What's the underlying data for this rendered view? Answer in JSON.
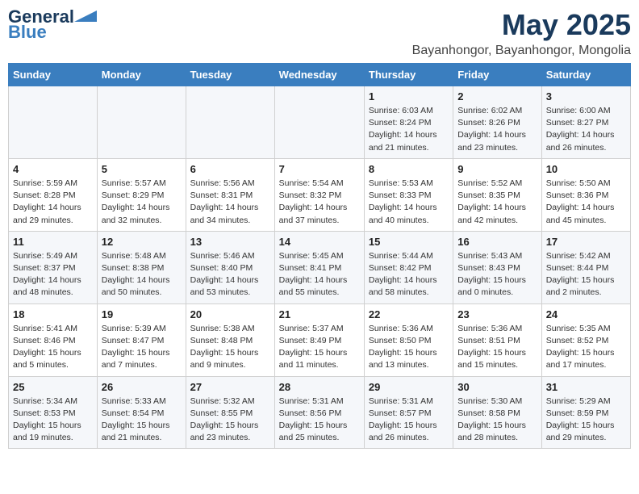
{
  "logo": {
    "general": "General",
    "blue": "Blue"
  },
  "title": "May 2025",
  "subtitle": "Bayanhongor, Bayanhongor, Mongolia",
  "headers": [
    "Sunday",
    "Monday",
    "Tuesday",
    "Wednesday",
    "Thursday",
    "Friday",
    "Saturday"
  ],
  "weeks": [
    [
      {
        "day": "",
        "info": ""
      },
      {
        "day": "",
        "info": ""
      },
      {
        "day": "",
        "info": ""
      },
      {
        "day": "",
        "info": ""
      },
      {
        "day": "1",
        "info": "Sunrise: 6:03 AM\nSunset: 8:24 PM\nDaylight: 14 hours\nand 21 minutes."
      },
      {
        "day": "2",
        "info": "Sunrise: 6:02 AM\nSunset: 8:26 PM\nDaylight: 14 hours\nand 23 minutes."
      },
      {
        "day": "3",
        "info": "Sunrise: 6:00 AM\nSunset: 8:27 PM\nDaylight: 14 hours\nand 26 minutes."
      }
    ],
    [
      {
        "day": "4",
        "info": "Sunrise: 5:59 AM\nSunset: 8:28 PM\nDaylight: 14 hours\nand 29 minutes."
      },
      {
        "day": "5",
        "info": "Sunrise: 5:57 AM\nSunset: 8:29 PM\nDaylight: 14 hours\nand 32 minutes."
      },
      {
        "day": "6",
        "info": "Sunrise: 5:56 AM\nSunset: 8:31 PM\nDaylight: 14 hours\nand 34 minutes."
      },
      {
        "day": "7",
        "info": "Sunrise: 5:54 AM\nSunset: 8:32 PM\nDaylight: 14 hours\nand 37 minutes."
      },
      {
        "day": "8",
        "info": "Sunrise: 5:53 AM\nSunset: 8:33 PM\nDaylight: 14 hours\nand 40 minutes."
      },
      {
        "day": "9",
        "info": "Sunrise: 5:52 AM\nSunset: 8:35 PM\nDaylight: 14 hours\nand 42 minutes."
      },
      {
        "day": "10",
        "info": "Sunrise: 5:50 AM\nSunset: 8:36 PM\nDaylight: 14 hours\nand 45 minutes."
      }
    ],
    [
      {
        "day": "11",
        "info": "Sunrise: 5:49 AM\nSunset: 8:37 PM\nDaylight: 14 hours\nand 48 minutes."
      },
      {
        "day": "12",
        "info": "Sunrise: 5:48 AM\nSunset: 8:38 PM\nDaylight: 14 hours\nand 50 minutes."
      },
      {
        "day": "13",
        "info": "Sunrise: 5:46 AM\nSunset: 8:40 PM\nDaylight: 14 hours\nand 53 minutes."
      },
      {
        "day": "14",
        "info": "Sunrise: 5:45 AM\nSunset: 8:41 PM\nDaylight: 14 hours\nand 55 minutes."
      },
      {
        "day": "15",
        "info": "Sunrise: 5:44 AM\nSunset: 8:42 PM\nDaylight: 14 hours\nand 58 minutes."
      },
      {
        "day": "16",
        "info": "Sunrise: 5:43 AM\nSunset: 8:43 PM\nDaylight: 15 hours\nand 0 minutes."
      },
      {
        "day": "17",
        "info": "Sunrise: 5:42 AM\nSunset: 8:44 PM\nDaylight: 15 hours\nand 2 minutes."
      }
    ],
    [
      {
        "day": "18",
        "info": "Sunrise: 5:41 AM\nSunset: 8:46 PM\nDaylight: 15 hours\nand 5 minutes."
      },
      {
        "day": "19",
        "info": "Sunrise: 5:39 AM\nSunset: 8:47 PM\nDaylight: 15 hours\nand 7 minutes."
      },
      {
        "day": "20",
        "info": "Sunrise: 5:38 AM\nSunset: 8:48 PM\nDaylight: 15 hours\nand 9 minutes."
      },
      {
        "day": "21",
        "info": "Sunrise: 5:37 AM\nSunset: 8:49 PM\nDaylight: 15 hours\nand 11 minutes."
      },
      {
        "day": "22",
        "info": "Sunrise: 5:36 AM\nSunset: 8:50 PM\nDaylight: 15 hours\nand 13 minutes."
      },
      {
        "day": "23",
        "info": "Sunrise: 5:36 AM\nSunset: 8:51 PM\nDaylight: 15 hours\nand 15 minutes."
      },
      {
        "day": "24",
        "info": "Sunrise: 5:35 AM\nSunset: 8:52 PM\nDaylight: 15 hours\nand 17 minutes."
      }
    ],
    [
      {
        "day": "25",
        "info": "Sunrise: 5:34 AM\nSunset: 8:53 PM\nDaylight: 15 hours\nand 19 minutes."
      },
      {
        "day": "26",
        "info": "Sunrise: 5:33 AM\nSunset: 8:54 PM\nDaylight: 15 hours\nand 21 minutes."
      },
      {
        "day": "27",
        "info": "Sunrise: 5:32 AM\nSunset: 8:55 PM\nDaylight: 15 hours\nand 23 minutes."
      },
      {
        "day": "28",
        "info": "Sunrise: 5:31 AM\nSunset: 8:56 PM\nDaylight: 15 hours\nand 25 minutes."
      },
      {
        "day": "29",
        "info": "Sunrise: 5:31 AM\nSunset: 8:57 PM\nDaylight: 15 hours\nand 26 minutes."
      },
      {
        "day": "30",
        "info": "Sunrise: 5:30 AM\nSunset: 8:58 PM\nDaylight: 15 hours\nand 28 minutes."
      },
      {
        "day": "31",
        "info": "Sunrise: 5:29 AM\nSunset: 8:59 PM\nDaylight: 15 hours\nand 29 minutes."
      }
    ]
  ]
}
